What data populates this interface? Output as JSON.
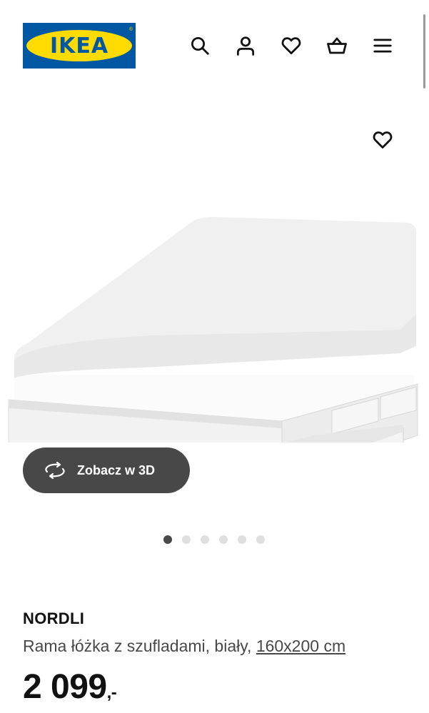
{
  "header": {
    "logo_text": "IKEA",
    "logo_registered": "®",
    "icons": [
      "search-icon",
      "account-icon",
      "favourites-icon",
      "basket-icon",
      "menu-icon"
    ]
  },
  "gallery": {
    "view_3d_label": "Zobacz w 3D",
    "slides_total": 6,
    "active_slide": 1
  },
  "product": {
    "name": "NORDLI",
    "description": "Rama łóżka z szufladami, biały, ",
    "size": "160x200 cm",
    "price": "2 099",
    "price_suffix": ",-"
  },
  "colors": {
    "ikea_blue": "#0058a3",
    "ikea_yellow": "#ffdb00",
    "button_dark": "#484848"
  }
}
